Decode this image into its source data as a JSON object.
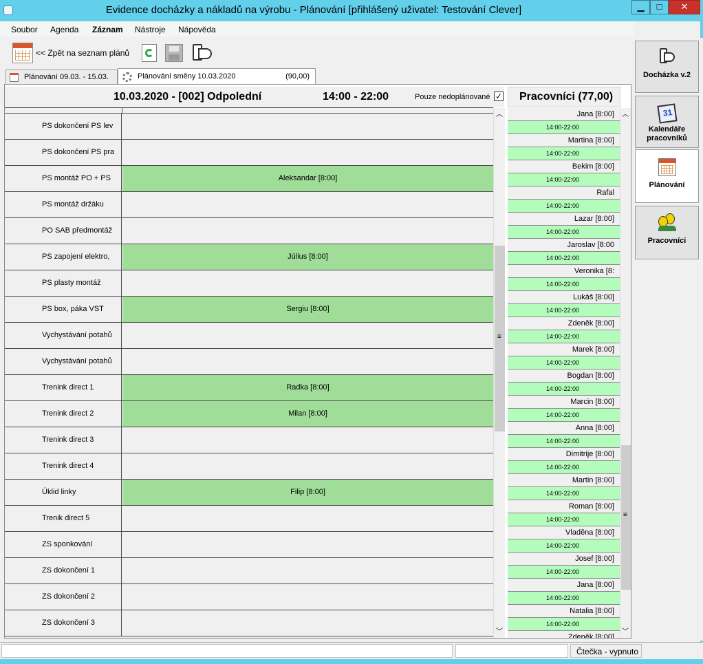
{
  "window": {
    "title": "Evidence docházky a nákladů na výrobu - Plánování [přihlášený uživatel: Testování Clever]",
    "min_label": "▁",
    "max_label": "□",
    "close_label": "✕"
  },
  "menu": {
    "items": [
      "Soubor",
      "Agenda",
      "Záznam",
      "Nástroje",
      "Nápověda"
    ]
  },
  "toolbar": {
    "back_label": "<< Zpět na seznam plánů",
    "icons": [
      "calendar-icon",
      "refresh-icon",
      "save-icon",
      "document-icon"
    ]
  },
  "tabs": [
    {
      "label": "Plánování 09.03. - 15.03.",
      "extra": ""
    },
    {
      "label": "Plánování směny 10.03.2020",
      "extra": "(90,00)"
    }
  ],
  "shift": {
    "title": "10.03.2020 - [002] Odpolední",
    "time": "14:00 - 22:00",
    "filter_label": "Pouze nedoplánované",
    "filter_checked": true
  },
  "grid": {
    "rows": [
      {
        "name": "PS dokončení PS lev",
        "worker": ""
      },
      {
        "name": "PS dokončení PS pra",
        "worker": ""
      },
      {
        "name": "PS montáž PO + PS",
        "worker": "Aleksandar [8:00]"
      },
      {
        "name": "PS montáž držáku",
        "worker": ""
      },
      {
        "name": "PO SAB předmontáž",
        "worker": ""
      },
      {
        "name": "PS zapojení elektro,",
        "worker": "Július [8:00]"
      },
      {
        "name": "PS plasty montáž",
        "worker": ""
      },
      {
        "name": "PS box, páka VST",
        "worker": "Sergiu [8:00]"
      },
      {
        "name": "Vychystávání potahů",
        "worker": ""
      },
      {
        "name": "Vychystávání potahů",
        "worker": ""
      },
      {
        "name": "Trenink direct 1",
        "worker": "Radka [8:00]"
      },
      {
        "name": "Trenink direct 2",
        "worker": "Milan [8:00]"
      },
      {
        "name": "Trenink direct 3",
        "worker": ""
      },
      {
        "name": "Trenink direct 4",
        "worker": ""
      },
      {
        "name": "Úklid linky",
        "worker": "Filip [8:00]"
      },
      {
        "name": "Trenik direct 5",
        "worker": ""
      },
      {
        "name": "ZS sponkování",
        "worker": ""
      },
      {
        "name": "ZS dokončení 1",
        "worker": ""
      },
      {
        "name": "ZS dokončení 2",
        "worker": ""
      },
      {
        "name": "ZS dokončení 3",
        "worker": ""
      }
    ]
  },
  "workers": {
    "title": "Pracovníci (77,00)",
    "items": [
      {
        "name": "Jana [8:00]",
        "time": "14:00-22:00"
      },
      {
        "name": "Martina [8:00]",
        "time": "14:00-22:00"
      },
      {
        "name": "Bekim [8:00]",
        "time": "14:00-22:00"
      },
      {
        "name": "Rafal",
        "time": "14:00-22:00"
      },
      {
        "name": "Lazar [8:00]",
        "time": "14:00-22:00"
      },
      {
        "name": "Jaroslav [8:00",
        "time": "14:00-22:00"
      },
      {
        "name": "Veronika [8:",
        "time": "14:00-22:00"
      },
      {
        "name": "Lukáš [8:00]",
        "time": "14:00-22:00"
      },
      {
        "name": "Zdeněk [8:00]",
        "time": "14:00-22:00"
      },
      {
        "name": "Marek [8:00]",
        "time": "14:00-22:00"
      },
      {
        "name": "Bogdan [8:00]",
        "time": "14:00-22:00"
      },
      {
        "name": "Marcin [8:00]",
        "time": "14:00-22:00"
      },
      {
        "name": "Anna [8:00]",
        "time": "14:00-22:00"
      },
      {
        "name": "Dimitrije [8:00]",
        "time": "14:00-22:00"
      },
      {
        "name": "Martin [8:00]",
        "time": "14:00-22:00"
      },
      {
        "name": "Roman [8:00]",
        "time": "14:00-22:00"
      },
      {
        "name": "Vladěna [8:00]",
        "time": "14:00-22:00"
      },
      {
        "name": "Josef [8:00]",
        "time": "14:00-22:00"
      },
      {
        "name": "Jana [8:00]",
        "time": "14:00-22:00"
      },
      {
        "name": "Natalia [8:00]",
        "time": "14:00-22:00"
      },
      {
        "name": "Zdeněk [8:00]",
        "time": ""
      }
    ]
  },
  "side": {
    "items": [
      {
        "label": "Docházka v.2",
        "icon": "document-icon"
      },
      {
        "label": "Kalendáře pracovníků",
        "icon": "calendar-icon"
      },
      {
        "label": "Plánování",
        "icon": "planner-icon"
      },
      {
        "label": "Pracovníci",
        "icon": "people-icon"
      }
    ]
  },
  "status": {
    "reader": "Čtečka - vypnuto"
  },
  "colors": {
    "titlebar": "#62cfeb",
    "assigned": "#9fdd98",
    "worker_time": "#b4fcbc",
    "close": "#c7312c"
  }
}
